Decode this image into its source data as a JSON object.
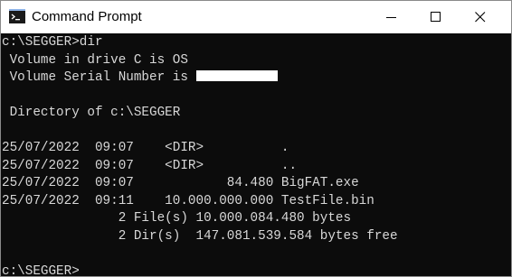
{
  "window": {
    "title": "Command Prompt",
    "icon": "cmd-icon",
    "controls": [
      "minimize-icon",
      "maximize-icon",
      "close-icon"
    ]
  },
  "terminal": {
    "lines": [
      "c:\\SEGGER>dir",
      " Volume in drive C is OS",
      " Volume Serial Number is ",
      "",
      " Directory of c:\\SEGGER",
      "",
      "25/07/2022  09:07    <DIR>          .",
      "25/07/2022  09:07    <DIR>          ..",
      "25/07/2022  09:07            84.480 BigFAT.exe",
      "25/07/2022  09:11    10.000.000.000 TestFile.bin",
      "               2 File(s) 10.000.084.480 bytes",
      "               2 Dir(s)  147.081.539.584 bytes free",
      "",
      "c:\\SEGGER>"
    ]
  }
}
